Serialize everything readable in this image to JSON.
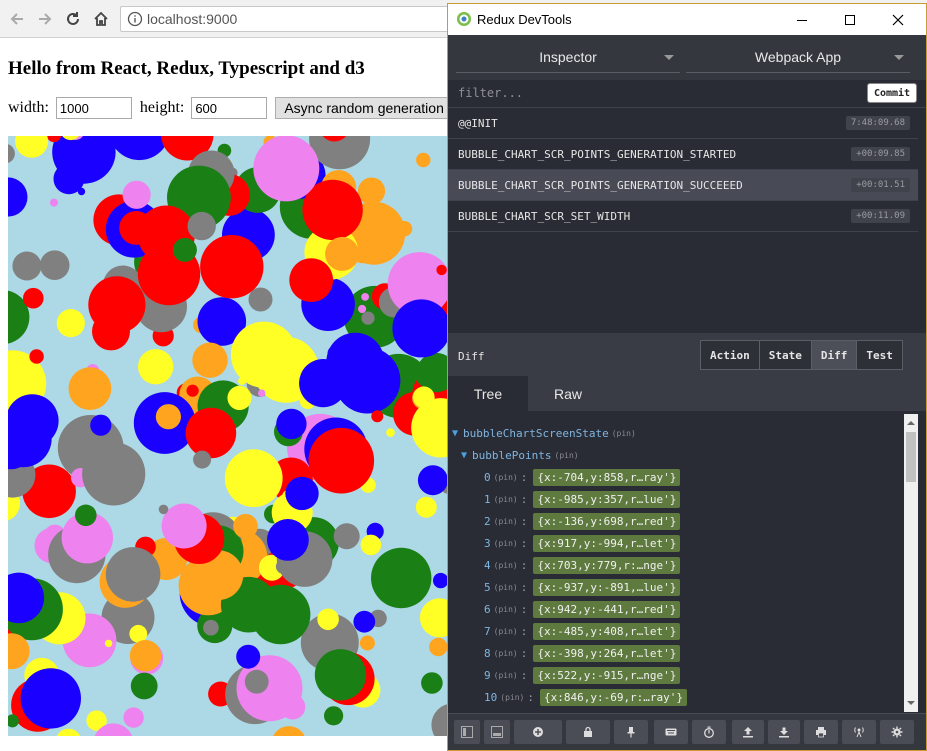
{
  "browser": {
    "url": "localhost:9000"
  },
  "page": {
    "title": "Hello from React, Redux, Typescript and d3",
    "width_label": "width:",
    "width_value": "1000",
    "height_label": "height:",
    "height_value": "600",
    "generate_button": "Async random generation"
  },
  "chart_data": {
    "type": "scatter",
    "title": "",
    "background": "#add8e6",
    "colors": [
      "#ff0000",
      "#1a00ff",
      "#ffff26",
      "#1a8016",
      "#ffa41f",
      "#ee82ee",
      "#808080"
    ]
  },
  "devtools": {
    "title": "Redux DevTools",
    "monitor": "Inspector",
    "instance": "Webpack App",
    "filter_placeholder": "filter...",
    "commit": "Commit",
    "actions": [
      {
        "name": "@@INIT",
        "time": "7:48:09.68"
      },
      {
        "name": "BUBBLE_CHART_SCR_POINTS_GENERATION_STARTED",
        "time": "+00:09.85"
      },
      {
        "name": "BUBBLE_CHART_SCR_POINTS_GENERATION_SUCCEEED",
        "time": "+00:01.51"
      },
      {
        "name": "BUBBLE_CHART_SCR_SET_WIDTH",
        "time": "+00:11.09"
      }
    ],
    "diff_label": "Diff",
    "tabs": [
      "Action",
      "State",
      "Diff",
      "Test"
    ],
    "view_tabs": [
      "Tree",
      "Raw"
    ],
    "tree": {
      "root_key": "bubbleChartScreenState",
      "child_key": "bubblePoints",
      "pin": "(pin)",
      "items": [
        {
          "index": "0",
          "value": "{x:-704,y:858,r…ray'}"
        },
        {
          "index": "1",
          "value": "{x:-985,y:357,r…lue'}"
        },
        {
          "index": "2",
          "value": "{x:-136,y:698,r…red'}"
        },
        {
          "index": "3",
          "value": "{x:917,y:-994,r…let'}"
        },
        {
          "index": "4",
          "value": "{x:703,y:779,r:…nge'}"
        },
        {
          "index": "5",
          "value": "{x:-937,y:-891,…lue'}"
        },
        {
          "index": "6",
          "value": "{x:942,y:-441,r…red'}"
        },
        {
          "index": "7",
          "value": "{x:-485,y:408,r…let'}"
        },
        {
          "index": "8",
          "value": "{x:-398,y:264,r…let'}"
        },
        {
          "index": "9",
          "value": "{x:522,y:-915,r…nge'}"
        },
        {
          "index": "10",
          "value": "{x:846,y:-69,r:…ray'}"
        }
      ]
    },
    "footer_icons": [
      "layout-left-icon",
      "layout-bottom-icon",
      "dispatch-icon",
      "lock-icon",
      "pin-icon",
      "keyboard-icon",
      "timer-icon",
      "upload-icon",
      "download-icon",
      "print-icon",
      "remote-icon",
      "settings-icon"
    ]
  }
}
